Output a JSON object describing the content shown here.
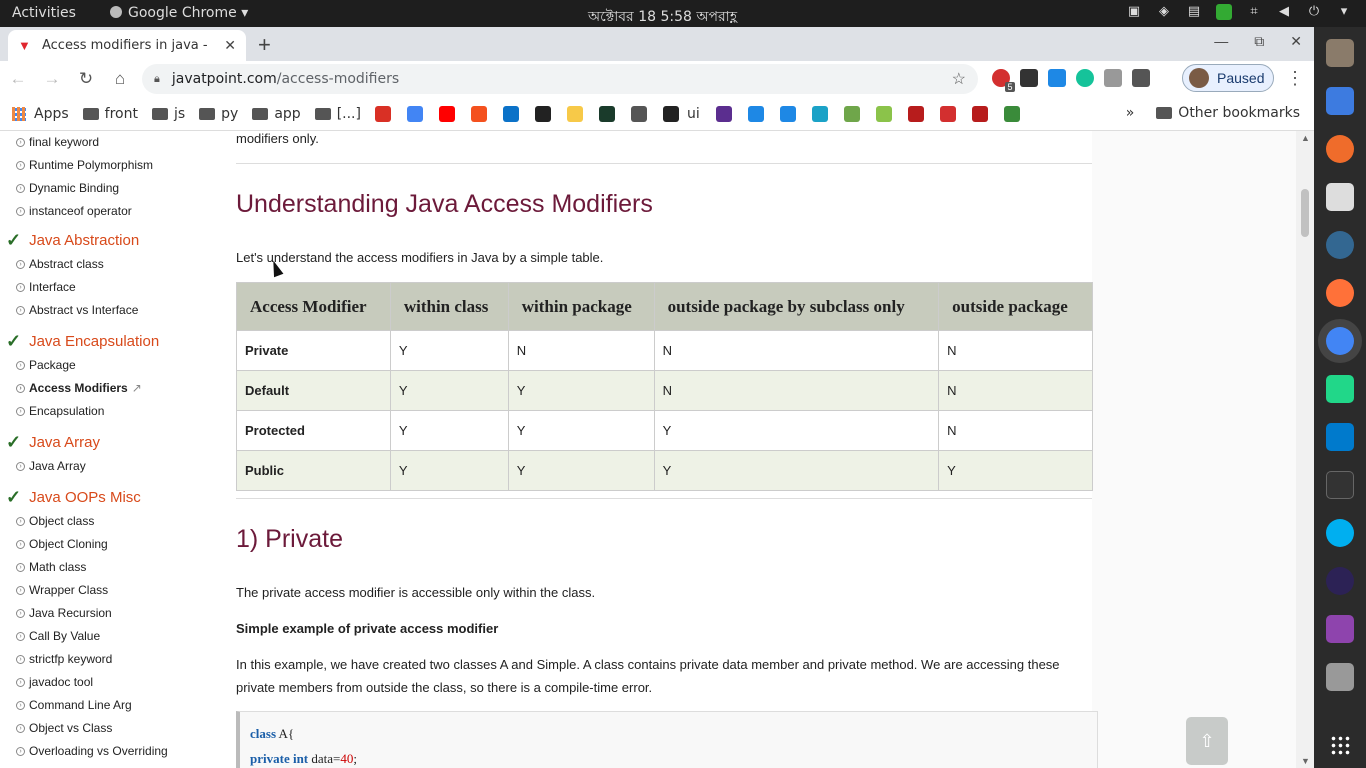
{
  "topbar": {
    "activities": "Activities",
    "app_name": "Google Chrome",
    "app_arrow": "▾",
    "clock": "অক্টোবর 18   5:58 অপরাহ্ণ",
    "tray_icons": [
      "camera-icon",
      "mail-icon",
      "screen-icon",
      "shield-icon",
      "network-icon",
      "volume-icon",
      "power-icon"
    ]
  },
  "browser": {
    "tab_title": "Access modifiers in java - ",
    "tab_close": "✕",
    "new_tab": "+",
    "url_domain": "javatpoint.com",
    "url_path": "/access-modifiers",
    "profile_label": "Paused",
    "window_controls": [
      "—",
      "⧉",
      "✕"
    ],
    "extension_badge": "5"
  },
  "bookmarks": {
    "apps": "Apps",
    "folders": [
      "front",
      "js",
      "py",
      "app",
      "[...]"
    ],
    "ui_label": "ui",
    "other": "Other bookmarks",
    "overflow": "»",
    "icon_colors": [
      "#d93025",
      "#4285f4",
      "#ff0000",
      "#f4511e",
      "#0b72c8",
      "#222",
      "#f7c948",
      "#1a3b2b",
      "#555",
      "#222",
      "#5b2e8f",
      "#1e88e5",
      "#1e88e5",
      "#1ba2c7",
      "#6fa64a",
      "#8bc34a",
      "#b71c1c",
      "#d32f2f",
      "#b71c1c",
      "#3a8b3a"
    ]
  },
  "sidebar": {
    "groups": [
      {
        "type": "item",
        "label": "final keyword"
      },
      {
        "type": "item",
        "label": "Runtime Polymorphism"
      },
      {
        "type": "item",
        "label": "Dynamic Binding"
      },
      {
        "type": "item",
        "label": "instanceof operator"
      },
      {
        "type": "head",
        "label": "Java Abstraction"
      },
      {
        "type": "item",
        "label": "Abstract class"
      },
      {
        "type": "item",
        "label": "Interface"
      },
      {
        "type": "item",
        "label": "Abstract vs Interface"
      },
      {
        "type": "head",
        "label": "Java Encapsulation"
      },
      {
        "type": "item",
        "label": "Package"
      },
      {
        "type": "item",
        "label": "Access Modifiers",
        "active": true
      },
      {
        "type": "item",
        "label": "Encapsulation"
      },
      {
        "type": "head",
        "label": "Java Array"
      },
      {
        "type": "item",
        "label": "Java Array"
      },
      {
        "type": "head",
        "label": "Java OOPs Misc"
      },
      {
        "type": "item",
        "label": "Object class"
      },
      {
        "type": "item",
        "label": "Object Cloning"
      },
      {
        "type": "item",
        "label": "Math class"
      },
      {
        "type": "item",
        "label": "Wrapper Class"
      },
      {
        "type": "item",
        "label": "Java Recursion"
      },
      {
        "type": "item",
        "label": "Call By Value"
      },
      {
        "type": "item",
        "label": "strictfp keyword"
      },
      {
        "type": "item",
        "label": "javadoc tool"
      },
      {
        "type": "item",
        "label": "Command Line Arg"
      },
      {
        "type": "item",
        "label": "Object vs Class"
      },
      {
        "type": "item",
        "label": "Overloading vs Overriding"
      }
    ]
  },
  "article": {
    "top_text": "modifiers only.",
    "heading1": "Understanding Java Access Modifiers",
    "intro": "Let's understand the access modifiers in Java by a simple table.",
    "table": {
      "headers": [
        "Access Modifier",
        "within class",
        "within package",
        "outside package by subclass only",
        "outside package"
      ],
      "rows": [
        [
          "Private",
          "Y",
          "N",
          "N",
          "N"
        ],
        [
          "Default",
          "Y",
          "Y",
          "N",
          "N"
        ],
        [
          "Protected",
          "Y",
          "Y",
          "Y",
          "N"
        ],
        [
          "Public",
          "Y",
          "Y",
          "Y",
          "Y"
        ]
      ]
    },
    "heading2": "1) Private",
    "private_desc": "The private access modifier is accessible only within the class.",
    "example_title": "Simple example of private access modifier",
    "example_desc": "In this example, we have created two classes A and Simple. A class contains private data member and private method. We are accessing these private members from outside the class, so there is a compile-time error.",
    "code": {
      "line1_kw": "class",
      "line1_rest": " A{",
      "line2_kw": "private int",
      "line2_rest": " data=",
      "line2_num": "40",
      "line2_end": ";"
    }
  },
  "scroll_top": "⇧",
  "colors": {
    "heading": "#6c1a3a",
    "sidebar_head": "#d84a1b",
    "table_header": "#c7cbbd",
    "check": "#2a6e28"
  }
}
